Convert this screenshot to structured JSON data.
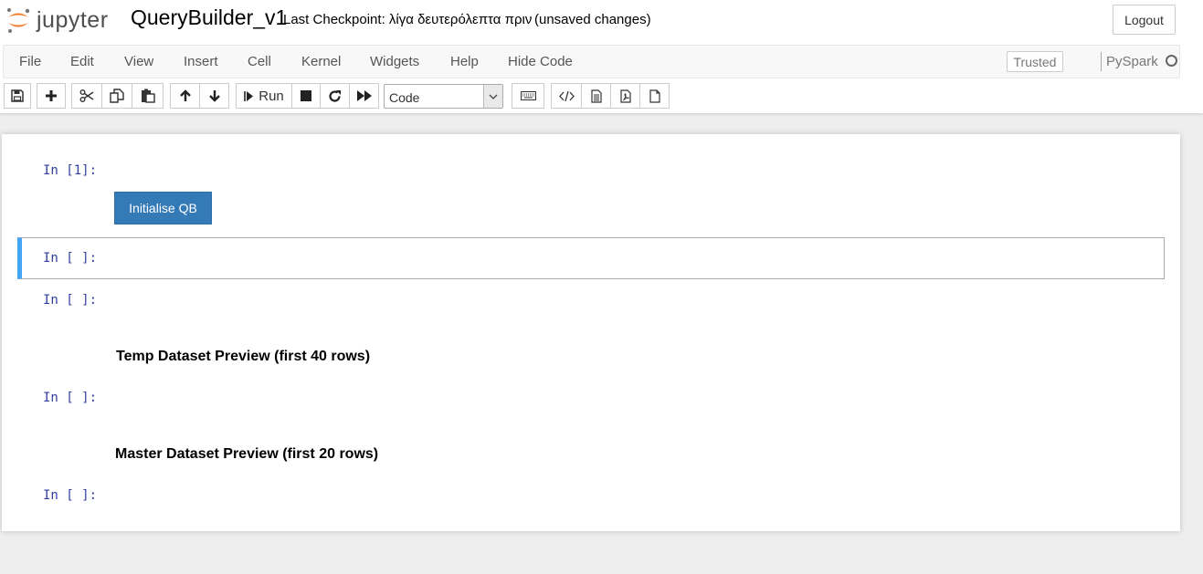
{
  "header": {
    "logo_text": "jupyter",
    "notebook_name": "QueryBuilder_v1",
    "checkpoint": "Last Checkpoint: λίγα δευτερόλεπτα πριν",
    "unsaved": "(unsaved changes)",
    "logout_label": "Logout",
    "logo_colors": {
      "orange": "#f37726",
      "gray": "#767677"
    }
  },
  "menubar": {
    "items": [
      "File",
      "Edit",
      "View",
      "Insert",
      "Cell",
      "Kernel",
      "Widgets",
      "Help",
      "Hide Code"
    ],
    "trusted_label": "Trusted",
    "kernel_name": "PySpark"
  },
  "toolbar": {
    "buttons": [
      "save-icon",
      "plus-icon",
      "cut-icon",
      "copy-icon",
      "paste-icon",
      "arrow-up-icon",
      "arrow-down-icon",
      "run-icon",
      "stop-icon",
      "restart-icon",
      "fast-forward-icon",
      "keyboard-icon",
      "code-icon",
      "file-text-icon",
      "file-pdf-icon",
      "file-icon"
    ],
    "run_label": "Run",
    "cell_type": "Code"
  },
  "cells": [
    {
      "prompt": "In [1]:",
      "widget_button": "Initialise QB"
    },
    {
      "prompt": "In [ ]:",
      "selected": true
    },
    {
      "prompt": "In [ ]:",
      "output_heading": "Temp Dataset Preview (first 40 rows)"
    },
    {
      "prompt": "In [ ]:",
      "output_heading": "Master Dataset Preview (first 20 rows)"
    },
    {
      "prompt": "In [ ]:"
    }
  ],
  "colors": {
    "accent_selected": "#42a5f5",
    "widget_button": "#337ab7",
    "prompt": "#303f9f"
  }
}
